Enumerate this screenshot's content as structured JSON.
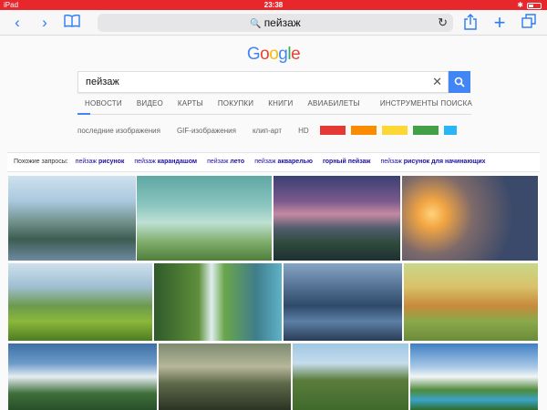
{
  "status": {
    "left": "iPad",
    "time": "23:38",
    "bluetooth": "✱"
  },
  "browser": {
    "address": "пейзаж",
    "icons": [
      "back-icon",
      "forward-icon",
      "bookmarks-icon",
      "search-icon",
      "reload-icon",
      "share-icon",
      "new-tab-icon",
      "tabs-icon"
    ]
  },
  "google": {
    "logo": [
      "G",
      "o",
      "o",
      "g",
      "l",
      "e"
    ],
    "logo_colors": [
      "#4285f4",
      "#ea4335",
      "#fbbc05",
      "#4285f4",
      "#34a853",
      "#ea4335"
    ],
    "query": "пейзаж",
    "tabs": [
      "НОВОСТИ",
      "ВИДЕО",
      "КАРТЫ",
      "ПОКУПКИ",
      "КНИГИ",
      "АВИАБИЛЕТЫ",
      "ИНСТРУМЕНТЫ ПОИСКА"
    ],
    "filters": [
      "последние изображения",
      "GIF-изображения",
      "клип-арт",
      "HD"
    ],
    "color_swatches": [
      "#e53935",
      "#fb8c00",
      "#fdd835",
      "#43a047",
      "#29b6f6"
    ],
    "related_label": "Похожие запросы:",
    "related": [
      {
        "base": "пейзаж",
        "bold": "рисунок"
      },
      {
        "base": "пейзаж",
        "bold": "карандашом"
      },
      {
        "base": "пейзаж",
        "bold": "лето"
      },
      {
        "base": "пейзаж",
        "bold": "акварелью"
      },
      {
        "base": "",
        "bold": "горный пейзаж"
      },
      {
        "base": "пейзаж",
        "bold": "рисунок для начинающих"
      }
    ]
  }
}
